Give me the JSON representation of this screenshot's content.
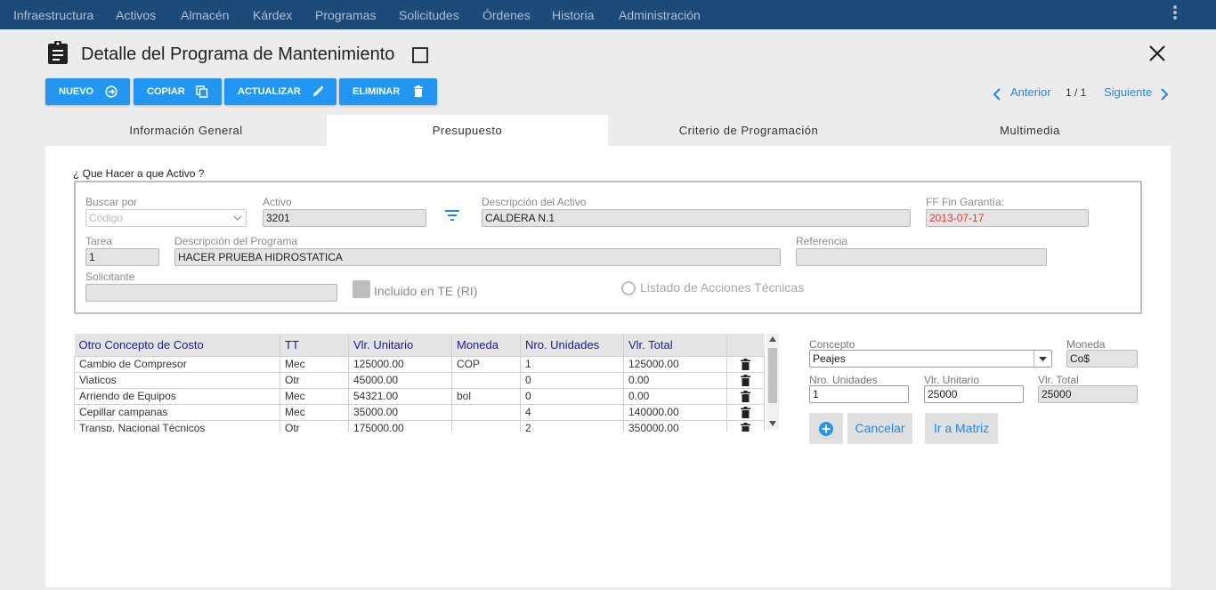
{
  "nav": [
    "Infraestructura",
    "Activos",
    "Almacén",
    "Kárdex",
    "Programas",
    "Solicitudes",
    "Órdenes",
    "Historia",
    "Administración"
  ],
  "nav_icons": {
    "more": "more-vert-icon"
  },
  "header": {
    "title": "Detalle del Programa de Mantenimiento",
    "icon": "clipboard-icon",
    "close_icon": "close-icon"
  },
  "toolbar": {
    "nuevo": "NUEVO",
    "copiar": "COPIAR",
    "actualizar": "ACTUALIZAR",
    "eliminar": "ELIMINAR"
  },
  "pager": {
    "prev": "Anterior",
    "position": "1 / 1",
    "next": "Siguiente"
  },
  "tabs": [
    "Información General",
    "Presupuesto",
    "Criterio de Programación",
    "Multimedia"
  ],
  "active_tab": "Presupuesto",
  "form": {
    "section_title": "¿ Que Hacer a que Activo ?",
    "buscar_por_label": "Buscar por",
    "buscar_por_value": "Código",
    "activo_label": "Activo",
    "activo_value": "3201",
    "descripcion_activo_label": "Descripción del Activo",
    "descripcion_activo_value": "CALDERA N.1",
    "ff_fin_garantia_label": "FF Fin Garantía:",
    "ff_fin_garantia_value": "2013-07-17",
    "tarea_label": "Tarea",
    "tarea_value": "1",
    "descripcion_programa_label": "Descripción del Programa",
    "descripcion_programa_value": "HACER PRUEBA HIDROSTATICA",
    "referencia_label": "Referencia",
    "referencia_value": "",
    "solicitante_label": "Solicitante",
    "solicitante_value": "",
    "incluido_te_label": "Incluido en TE (RI)",
    "listado_acciones_label": "Listado de Acciones Técnicas"
  },
  "cost_table": {
    "columns": [
      "Otro Concepto de Costo",
      "TT",
      "Vlr. Unitario",
      "Moneda",
      "Nro. Unidades",
      "Vlr. Total"
    ],
    "rows": [
      [
        "Cambio de Compresor",
        "Mec",
        "125000.00",
        "COP",
        "1",
        "125000.00"
      ],
      [
        "Viaticos",
        "Otr",
        "45000.00",
        "",
        "0",
        "0.00"
      ],
      [
        "Arriendo de Equipos",
        "Mec",
        "54321.00",
        "bol",
        "0",
        "0.00"
      ],
      [
        "Cepillar campanas",
        "Mec",
        "35000.00",
        "",
        "4",
        "140000.00"
      ],
      [
        "Transp. Nacional Técnicos",
        "Otr",
        "175000.00",
        "",
        "2",
        "350000.00"
      ]
    ]
  },
  "cost_editor": {
    "concepto_label": "Concepto",
    "concepto_value": "Peajes",
    "moneda_label": "Moneda",
    "moneda_value": "Co$",
    "nro_unidades_label": "Nro. Unidades",
    "nro_unidades_value": "1",
    "vlr_unitario_label": "Vlr. Unitario",
    "vlr_unitario_value": "25000",
    "vlr_total_label": "Vlr. Total",
    "vlr_total_value": "25000",
    "cancelar": "Cancelar",
    "ir_a_matriz": "Ir a Matriz"
  },
  "colors": {
    "nav_bg": "#1c4a78",
    "accent": "#2196f3",
    "link": "#1e88e5",
    "date_red": "#e53935",
    "header_text": "#1a1aa6"
  }
}
